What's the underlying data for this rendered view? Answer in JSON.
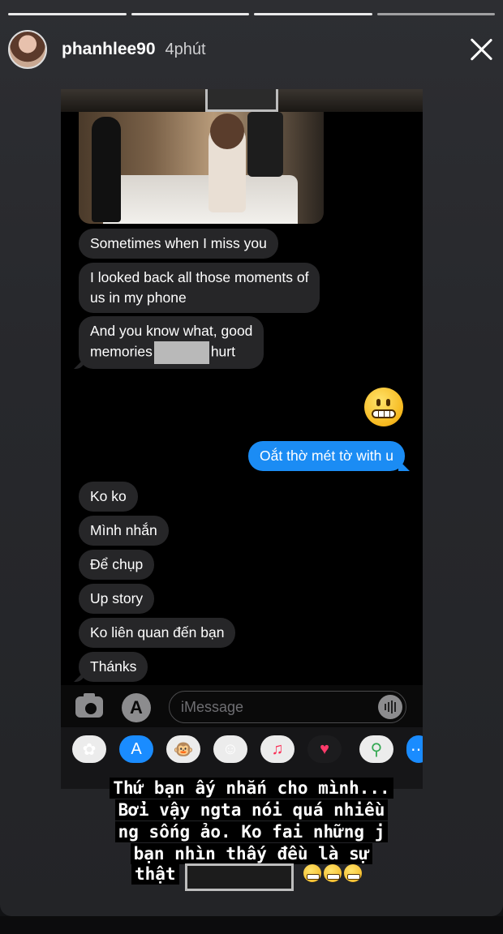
{
  "story": {
    "username": "phanhlee90",
    "time": "4phút"
  },
  "messages": [
    {
      "dir": "in",
      "text": "Sometimes when I miss you"
    },
    {
      "dir": "in",
      "lines": [
        "I looked back all those moments of",
        "us in my phone"
      ]
    },
    {
      "dir": "in",
      "line1": "And you know what, good",
      "line2_before": "memories",
      "line2_after": "hurt"
    },
    {
      "dir": "out",
      "text": "Oắt thờ mét tờ with u"
    },
    {
      "dir": "in",
      "text": "Ko ko"
    },
    {
      "dir": "in",
      "text": "Mình nhắn"
    },
    {
      "dir": "in",
      "text": "Để chụp"
    },
    {
      "dir": "in",
      "text": "Up story"
    },
    {
      "dir": "in",
      "text": "Ko liên quan đến bạn"
    },
    {
      "dir": "in",
      "text": "Thánks"
    }
  ],
  "compose": {
    "placeholder": "iMessage"
  },
  "apps": [
    "photos-icon",
    "app-store-icon",
    "monkey-memoji-icon",
    "memoji-icon",
    "music-icon",
    "digital-touch-icon",
    "maps-icon",
    "more-apps-icon"
  ],
  "caption": {
    "line1": "Thứ bạn ấy nhắn cho mình...",
    "line2": "Bởi vậy ngta nói quá nhiều",
    "line3": "ng sống ảo. Ko fai những j",
    "line4": "bạn nhìn thấy đều là sự",
    "line5": "thật"
  }
}
